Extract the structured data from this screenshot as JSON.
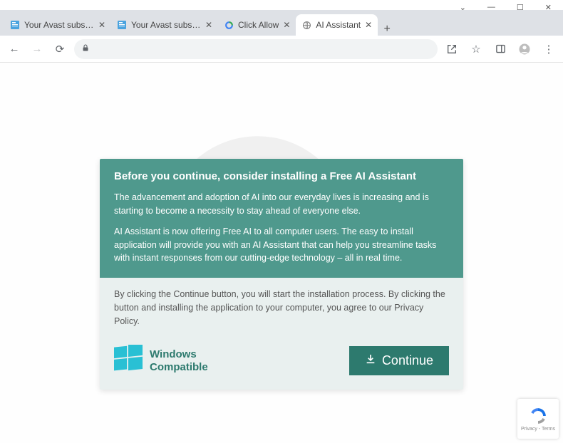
{
  "window": {
    "controls": {
      "dropdown": "⌄",
      "minimize": "—",
      "maximize": "☐",
      "close": "✕"
    }
  },
  "tabs": [
    {
      "title": "Your Avast subscription",
      "icon": "doc-blue",
      "close": "✕"
    },
    {
      "title": "Your Avast subscription",
      "icon": "doc-blue",
      "close": "✕"
    },
    {
      "title": "Click Allow",
      "icon": "recaptcha",
      "close": "✕"
    },
    {
      "title": "AI Assistant",
      "icon": "globe",
      "close": "✕",
      "active": true
    }
  ],
  "new_tab": "+",
  "toolbar": {
    "back": "←",
    "forward": "→",
    "reload": "⟳",
    "lock": "🔒",
    "share": "↗",
    "star": "☆",
    "panel": "▣",
    "profile": "👤",
    "menu": "⋮"
  },
  "card": {
    "h2": "Before you continue, consider installing a Free AI Assistant",
    "p1": "The advancement and adoption of AI into our everyday lives is increasing and is starting to become a necessity to stay ahead of everyone else.",
    "p2": "AI Assistant is now offering Free AI to all computer users. The easy to install application will provide you with an AI Assistant that can help you streamline tasks with instant responses from our cutting-edge technology – all in real time.",
    "mid": "By clicking the Continue button, you will start the installation process. By clicking the button and installing the application to your computer, you agree to our Privacy Policy.",
    "compat_l1": "Windows",
    "compat_l2": "Compatible",
    "continue": "Continue"
  },
  "recaptcha": {
    "text": "Privacy - Terms"
  }
}
